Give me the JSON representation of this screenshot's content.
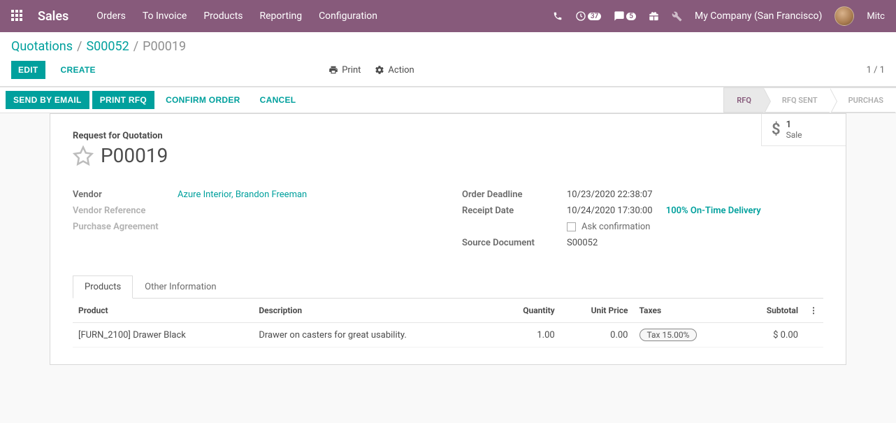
{
  "nav": {
    "brand": "Sales",
    "links": [
      "Orders",
      "To Invoice",
      "Products",
      "Reporting",
      "Configuration"
    ],
    "badge_activities": "37",
    "badge_discuss": "5",
    "company": "My Company (San Francisco)",
    "user": "Mitc"
  },
  "breadcrumb": {
    "root": "Quotations",
    "mid": "S00052",
    "current": "P00019"
  },
  "buttons": {
    "edit": "EDIT",
    "create": "CREATE",
    "print": "Print",
    "action": "Action",
    "pager": "1 / 1",
    "send_email": "SEND BY EMAIL",
    "print_rfq": "PRINT RFQ",
    "confirm": "CONFIRM ORDER",
    "cancel": "CANCEL"
  },
  "stages": {
    "rfq": "RFQ",
    "rfq_sent": "RFQ SENT",
    "purchase": "PURCHAS"
  },
  "statbox": {
    "count": "1",
    "label": "Sale"
  },
  "doc": {
    "type_label": "Request for Quotation",
    "name": "P00019"
  },
  "fields": {
    "vendor_label": "Vendor",
    "vendor_value": "Azure Interior, Brandon Freeman",
    "vendor_ref_label": "Vendor Reference",
    "purchase_agr_label": "Purchase Agreement",
    "order_deadline_label": "Order Deadline",
    "order_deadline_value": "10/23/2020 22:38:07",
    "receipt_date_label": "Receipt Date",
    "receipt_date_value": "10/24/2020 17:30:00",
    "on_time_delivery": "100% On-Time Delivery",
    "ask_confirmation": "Ask confirmation",
    "source_doc_label": "Source Document",
    "source_doc_value": "S00052"
  },
  "tabs": {
    "products": "Products",
    "other": "Other Information"
  },
  "table": {
    "headers": {
      "product": "Product",
      "description": "Description",
      "quantity": "Quantity",
      "unit_price": "Unit Price",
      "taxes": "Taxes",
      "subtotal": "Subtotal"
    },
    "rows": [
      {
        "product": "[FURN_2100] Drawer Black",
        "description": "Drawer on casters for great usability.",
        "quantity": "1.00",
        "unit_price": "0.00",
        "taxes": "Tax 15.00%",
        "subtotal": "$ 0.00"
      }
    ]
  }
}
